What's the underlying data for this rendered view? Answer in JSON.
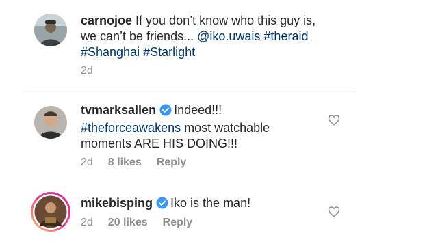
{
  "comments": [
    {
      "username": "carnojoe",
      "text_1": " If you don’t know who this guy is,",
      "text_2": "we can’t be friends... ",
      "mention": "@iko.uwais",
      "tag_1": "#theraid",
      "tag_2": "#Shanghai",
      "tag_3": "#Starlight",
      "time": "2d"
    },
    {
      "username": "tvmarksallen",
      "verified": true,
      "text_1": "Indeed!!!",
      "tag_1": "#theforceawakens",
      "text_2": " most watchable",
      "text_3": "moments ARE HIS DOING!!!",
      "time": "2d",
      "likes": "8 likes",
      "reply": "Reply"
    },
    {
      "username": "mikebisping",
      "verified": true,
      "text_1": "Iko is the man!",
      "time": "2d",
      "likes": "20 likes",
      "reply": "Reply"
    }
  ],
  "colors": {
    "hashtag": "#00376b",
    "verified_badge": "#3897f0",
    "story_ring": "#d6249f"
  }
}
